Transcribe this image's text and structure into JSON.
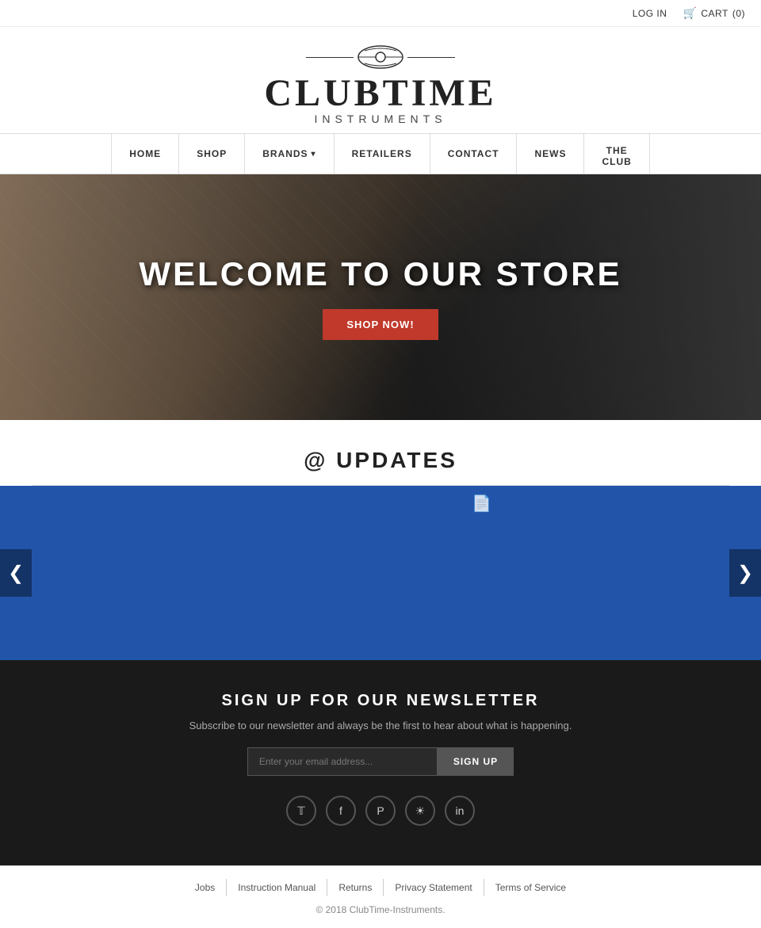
{
  "topbar": {
    "login_label": "LOG IN",
    "cart_label": "CART",
    "cart_count": "(0)"
  },
  "logo": {
    "name": "CLUBTIME",
    "subtitle": "INSTRUMENTS",
    "tagline_symbol": "◎"
  },
  "nav": {
    "items": [
      {
        "id": "home",
        "label": "HOME",
        "has_dropdown": false
      },
      {
        "id": "shop",
        "label": "SHOP",
        "has_dropdown": false
      },
      {
        "id": "brands",
        "label": "BRANDS",
        "has_dropdown": true
      },
      {
        "id": "retailers",
        "label": "RETAILERS",
        "has_dropdown": false
      },
      {
        "id": "contact",
        "label": "CONTACT",
        "has_dropdown": false
      },
      {
        "id": "news",
        "label": "NEWS",
        "has_dropdown": false
      },
      {
        "id": "the-club",
        "label": "THE CLUB",
        "has_dropdown": false
      }
    ]
  },
  "hero": {
    "title": "WELCOME TO OUR STORE",
    "cta_label": "SHOP NOW!"
  },
  "updates": {
    "title": "@ UPDATES",
    "at_symbol": "@"
  },
  "newsletter": {
    "title": "SIGN UP FOR OUR NEWSLETTER",
    "subtitle": "Subscribe to our newsletter and always be the first to hear about what is happening.",
    "input_placeholder": "Enter your email address...",
    "button_label": "SIGN UP"
  },
  "social": {
    "icons": [
      {
        "id": "twitter",
        "symbol": "𝕋",
        "label": "Twitter"
      },
      {
        "id": "facebook",
        "symbol": "f",
        "label": "Facebook"
      },
      {
        "id": "pinterest",
        "symbol": "P",
        "label": "Pinterest"
      },
      {
        "id": "instagram",
        "symbol": "📷",
        "label": "Instagram"
      },
      {
        "id": "linkedin",
        "symbol": "in",
        "label": "LinkedIn"
      }
    ]
  },
  "footer": {
    "links": [
      {
        "id": "jobs",
        "label": "Jobs"
      },
      {
        "id": "instruction-manual",
        "label": "Instruction Manual"
      },
      {
        "id": "returns",
        "label": "Returns"
      },
      {
        "id": "privacy-statement",
        "label": "Privacy Statement"
      },
      {
        "id": "terms",
        "label": "Terms of Service"
      }
    ],
    "copyright": "© 2018 ClubTime-Instruments."
  }
}
